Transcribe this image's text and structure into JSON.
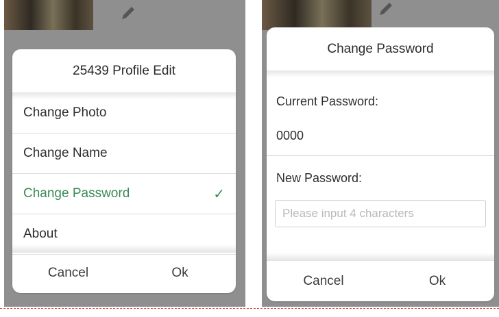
{
  "profile_dialog": {
    "title": "25439 Profile Edit",
    "items": [
      {
        "label": "Change Photo",
        "selected": false
      },
      {
        "label": "Change Name",
        "selected": false
      },
      {
        "label": "Change Password",
        "selected": true
      },
      {
        "label": "About",
        "selected": false
      }
    ],
    "check_mark": "✓",
    "cancel_label": "Cancel",
    "ok_label": "Ok"
  },
  "password_dialog": {
    "title": "Change Password",
    "current_label": "Current Password:",
    "current_value": "0000",
    "new_label": "New Password:",
    "new_placeholder": "Please input 4 characters",
    "new_value": "",
    "cancel_label": "Cancel",
    "ok_label": "Ok"
  },
  "colors": {
    "accent_green": "#3a8a57",
    "overlay": "#8f8f8f",
    "cut_line": "#e0443c"
  }
}
